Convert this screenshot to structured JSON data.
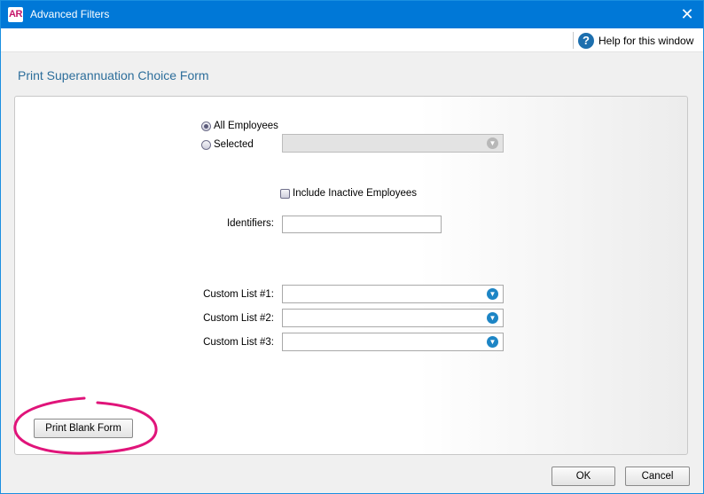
{
  "window": {
    "app_logo": "AR",
    "title": "Advanced Filters",
    "close_glyph": "✕"
  },
  "helpbar": {
    "help_label": "Help for this window",
    "help_glyph": "?"
  },
  "section_title": "Print Superannuation Choice Form",
  "employee_filter": {
    "all_employees_label": "All Employees",
    "all_employees_selected": true,
    "selected_label": "Selected",
    "selected_value": ""
  },
  "include_inactive": {
    "label": "Include Inactive Employees",
    "checked": false
  },
  "identifiers": {
    "label": "Identifiers:",
    "value": ""
  },
  "custom_lists": [
    {
      "label": "Custom List #1:",
      "value": ""
    },
    {
      "label": "Custom List #2:",
      "value": ""
    },
    {
      "label": "Custom List #3:",
      "value": ""
    }
  ],
  "buttons": {
    "print_blank_form": "Print Blank Form",
    "ok": "OK",
    "cancel": "Cancel"
  },
  "icons": {
    "dropdown": "chevron-down-circle-icon",
    "help": "help-question-icon",
    "close": "close-icon"
  },
  "colors": {
    "titlebar": "#0078d7",
    "section_title": "#2d6e9b",
    "annotation": "#e0147a"
  }
}
